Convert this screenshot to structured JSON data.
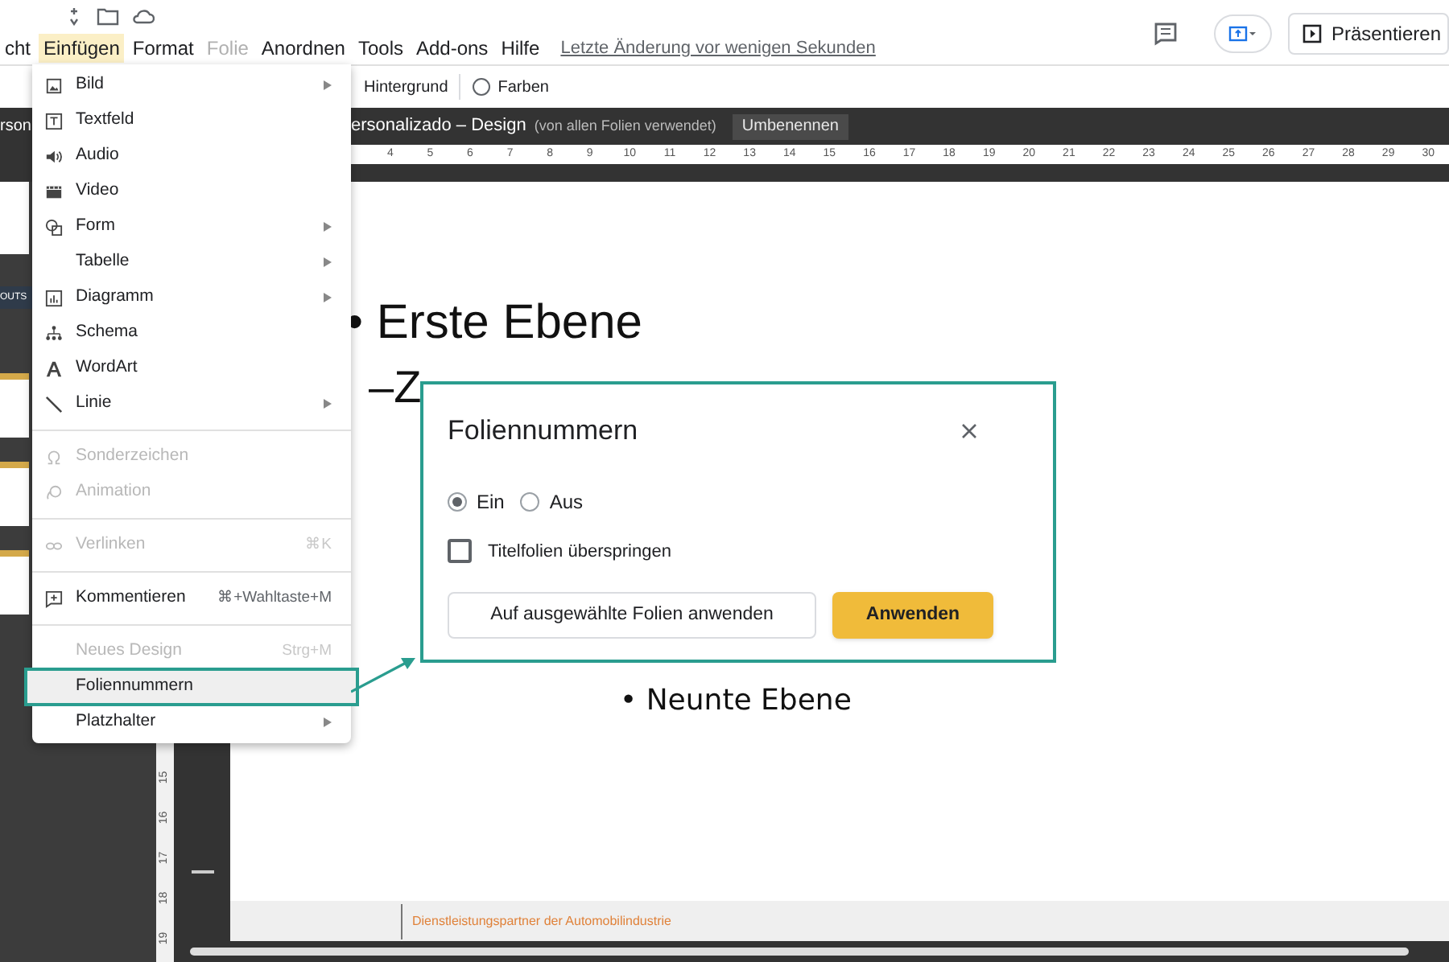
{
  "menu_bar": {
    "items": [
      {
        "label": "cht",
        "selected": false,
        "disabled": false
      },
      {
        "label": "Einfügen",
        "selected": true,
        "disabled": false
      },
      {
        "label": "Format",
        "selected": false,
        "disabled": false
      },
      {
        "label": "Folie",
        "selected": false,
        "disabled": true
      },
      {
        "label": "Anordnen",
        "selected": false,
        "disabled": false
      },
      {
        "label": "Tools",
        "selected": false,
        "disabled": false
      },
      {
        "label": "Add-ons",
        "selected": false,
        "disabled": false
      },
      {
        "label": "Hilfe",
        "selected": false,
        "disabled": false
      }
    ],
    "last_edit": "Letzte Änderung vor wenigen Sekunden",
    "present_button": "Präsentieren"
  },
  "toolbar": {
    "items": [
      "Hintergrund",
      "Farben"
    ]
  },
  "master_bar": {
    "left_label": "rson",
    "title": "ersonalizado – Design",
    "note": "(von allen Folien verwendet)",
    "rename_button": "Umbenennen"
  },
  "ruler": {
    "ticks": [
      "4",
      "5",
      "6",
      "7",
      "8",
      "9",
      "10",
      "11",
      "12",
      "13",
      "14",
      "15",
      "16",
      "17",
      "18",
      "19",
      "20",
      "21",
      "22",
      "23",
      "24",
      "25",
      "26",
      "27",
      "28",
      "29",
      "30"
    ]
  },
  "vertical_ruler": {
    "ticks": [
      "15",
      "16",
      "17",
      "18",
      "19"
    ]
  },
  "filmstrip": {
    "label": "OUTS"
  },
  "insert_menu": {
    "items": [
      {
        "kind": "item",
        "label": "Bild",
        "submenu": true,
        "disabled": false,
        "selected": false
      },
      {
        "kind": "item",
        "label": "Textfeld",
        "submenu": false,
        "disabled": false,
        "selected": false
      },
      {
        "kind": "item",
        "label": "Audio",
        "submenu": false,
        "disabled": false,
        "selected": false
      },
      {
        "kind": "item",
        "label": "Video",
        "submenu": false,
        "disabled": false,
        "selected": false
      },
      {
        "kind": "item",
        "label": "Form",
        "submenu": true,
        "disabled": false,
        "selected": false
      },
      {
        "kind": "item",
        "label": "Tabelle",
        "submenu": true,
        "disabled": false,
        "selected": false
      },
      {
        "kind": "item",
        "label": "Diagramm",
        "submenu": true,
        "disabled": false,
        "selected": false
      },
      {
        "kind": "item",
        "label": "Schema",
        "submenu": false,
        "disabled": false,
        "selected": false
      },
      {
        "kind": "item",
        "label": "WordArt",
        "submenu": false,
        "disabled": false,
        "selected": false
      },
      {
        "kind": "item",
        "label": "Linie",
        "submenu": true,
        "disabled": false,
        "selected": false
      },
      {
        "kind": "divider"
      },
      {
        "kind": "item",
        "label": "Sonderzeichen",
        "submenu": false,
        "disabled": true,
        "selected": false
      },
      {
        "kind": "item",
        "label": "Animation",
        "submenu": false,
        "disabled": true,
        "selected": false
      },
      {
        "kind": "divider"
      },
      {
        "kind": "item",
        "label": "Verlinken",
        "shortcut": "⌘K",
        "submenu": false,
        "disabled": true,
        "selected": false
      },
      {
        "kind": "divider"
      },
      {
        "kind": "item",
        "label": "Kommentieren",
        "shortcut": "⌘+Wahltaste+M",
        "submenu": false,
        "disabled": false,
        "selected": false
      },
      {
        "kind": "divider"
      },
      {
        "kind": "item",
        "label": "Neues Design",
        "shortcut": "Strg+M",
        "submenu": false,
        "disabled": true,
        "selected": false
      },
      {
        "kind": "item",
        "label": "Foliennummern",
        "submenu": false,
        "disabled": false,
        "selected": true
      },
      {
        "kind": "item",
        "label": "Platzhalter",
        "submenu": true,
        "disabled": false,
        "selected": false
      }
    ]
  },
  "slide": {
    "bullets": [
      {
        "kind": "large",
        "text": "• Erste Ebene"
      },
      {
        "kind": "dash",
        "text": "–Z"
      },
      {
        "kind": "small",
        "text": "• Neunte Ebene"
      }
    ],
    "footer": "Dienstleistungspartner der Automobilindustrie"
  },
  "dialog": {
    "title": "Foliennummern",
    "radios": [
      {
        "label": "Ein",
        "selected": true
      },
      {
        "label": "Aus",
        "selected": false
      }
    ],
    "checkbox": {
      "label": "Titelfolien überspringen",
      "checked": false
    },
    "buttons": [
      {
        "label": "Auf ausgewählte Folien anwenden",
        "kind": "secondary"
      },
      {
        "label": "Anwenden",
        "kind": "primary"
      }
    ]
  }
}
